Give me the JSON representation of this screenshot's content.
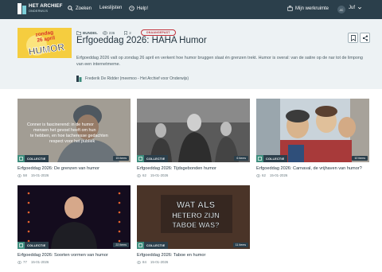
{
  "nav": {
    "logo_line1": "HET ARCHIEF",
    "logo_line2": "ONDERWIJS",
    "search": "Zoeken",
    "learning_paths": "Leeslijsten",
    "help": "Help!",
    "workspace": "Mijn werkruimte",
    "avatar_initials": "JC",
    "user_name": "Juf"
  },
  "header": {
    "thumb_lines": [
      "zondag",
      "26 april",
      "HUMOR"
    ],
    "type_label": "BUNDEL",
    "views": "236",
    "bookmarks": "2",
    "badge": "ONAANGEPAST",
    "title": "Erfgoeddag 2026: HAHA Humor",
    "description": "Erfgoeddag 2026 valt op zondag 26 april en verkent hoe humor bruggen slaat én grenzen trekt. Humor is overal: van de satire op de nar tot de limpong van een internetmeme.",
    "author": "Frederik De Ridder (meemoo - Het Archief voor Onderwijs)"
  },
  "cards": [
    {
      "chip": "COLLECTIE",
      "count": "15 items",
      "title": "Erfgoeddag 2026: De grenzen van humor",
      "views": "58",
      "date": "15-01-2026",
      "overlay": [
        "Conner is fascinerend: in de humor",
        "mensen het gevoel heeft om hun",
        "te hebben, en hoe lacheresse gedachten",
        "respect voor het publiek"
      ]
    },
    {
      "chip": "COLLECTIE",
      "count": "6 items",
      "title": "Erfgoeddag 2026: Tijdsgebonden humor",
      "views": "62",
      "date": "15-01-2026",
      "overlay": []
    },
    {
      "chip": "COLLECTIE",
      "count": "10 items",
      "title": "Erfgoeddag 2026: Carnaval, de vrijhaven van humor?",
      "views": "62",
      "date": "15-01-2026",
      "overlay": []
    },
    {
      "chip": "COLLECTIE",
      "count": "22 items",
      "title": "Erfgoeddag 2026: Soorten vormen van humor",
      "views": "77",
      "date": "15-01-2026",
      "overlay": []
    },
    {
      "chip": "COLLECTIE",
      "count": "11 items",
      "title": "Erfgoeddag 2026: Taboe en humor",
      "views": "84",
      "date": "15-01-2026",
      "overlay": [
        "WAT ALS",
        "HETERO ZIJN",
        "TABOE WAS?"
      ]
    }
  ]
}
